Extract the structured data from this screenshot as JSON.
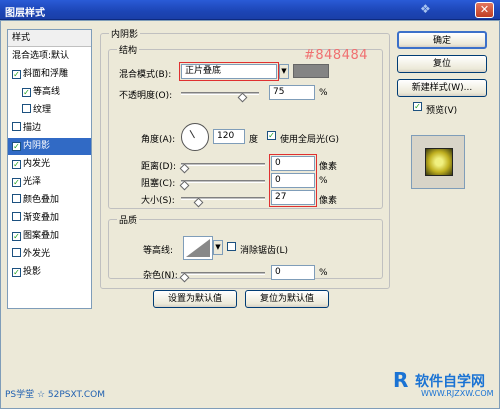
{
  "window": {
    "title": "图层样式",
    "close": "✕"
  },
  "sidebar": {
    "header": "样式",
    "blend_options": "混合选项:默认",
    "items": [
      {
        "label": "斜面和浮雕",
        "checked": true
      },
      {
        "label": "等高线",
        "checked": true
      },
      {
        "label": "纹理",
        "checked": false
      },
      {
        "label": "描边",
        "checked": false
      },
      {
        "label": "内阴影",
        "checked": true
      },
      {
        "label": "内发光",
        "checked": true
      },
      {
        "label": "光泽",
        "checked": true
      },
      {
        "label": "颜色叠加",
        "checked": false
      },
      {
        "label": "渐变叠加",
        "checked": false
      },
      {
        "label": "图案叠加",
        "checked": true
      },
      {
        "label": "外发光",
        "checked": false
      },
      {
        "label": "投影",
        "checked": true
      }
    ]
  },
  "panel": {
    "title": "内阴影",
    "structure": {
      "title": "结构",
      "blend_mode_label": "混合模式(B):",
      "blend_mode_value": "正片叠底",
      "color_hex": "#848484",
      "opacity_label": "不透明度(O):",
      "opacity_value": "75",
      "percent": "%",
      "angle_label": "角度(A):",
      "angle_value": "120",
      "degree": "度",
      "global_light_label": "使用全局光(G)",
      "distance_label": "距离(D):",
      "distance_value": "0",
      "choke_label": "阻塞(C):",
      "choke_value": "0",
      "size_label": "大小(S):",
      "size_value": "27",
      "pixels": "像素"
    },
    "quality": {
      "title": "品质",
      "contour_label": "等高线:",
      "antialias_label": "消除锯齿(L)",
      "noise_label": "杂色(N):",
      "noise_value": "0"
    },
    "set_default": "设置为默认值",
    "reset_default": "复位为默认值"
  },
  "actions": {
    "ok": "确定",
    "reset": "复位",
    "new_style": "新建样式(W)...",
    "preview": "预览(V)"
  },
  "watermarks": {
    "left": "PS学堂 ☆ 52PSXT.COM",
    "right_brand": "软件自学网",
    "right_url": "WWW.RJZXW.COM"
  }
}
